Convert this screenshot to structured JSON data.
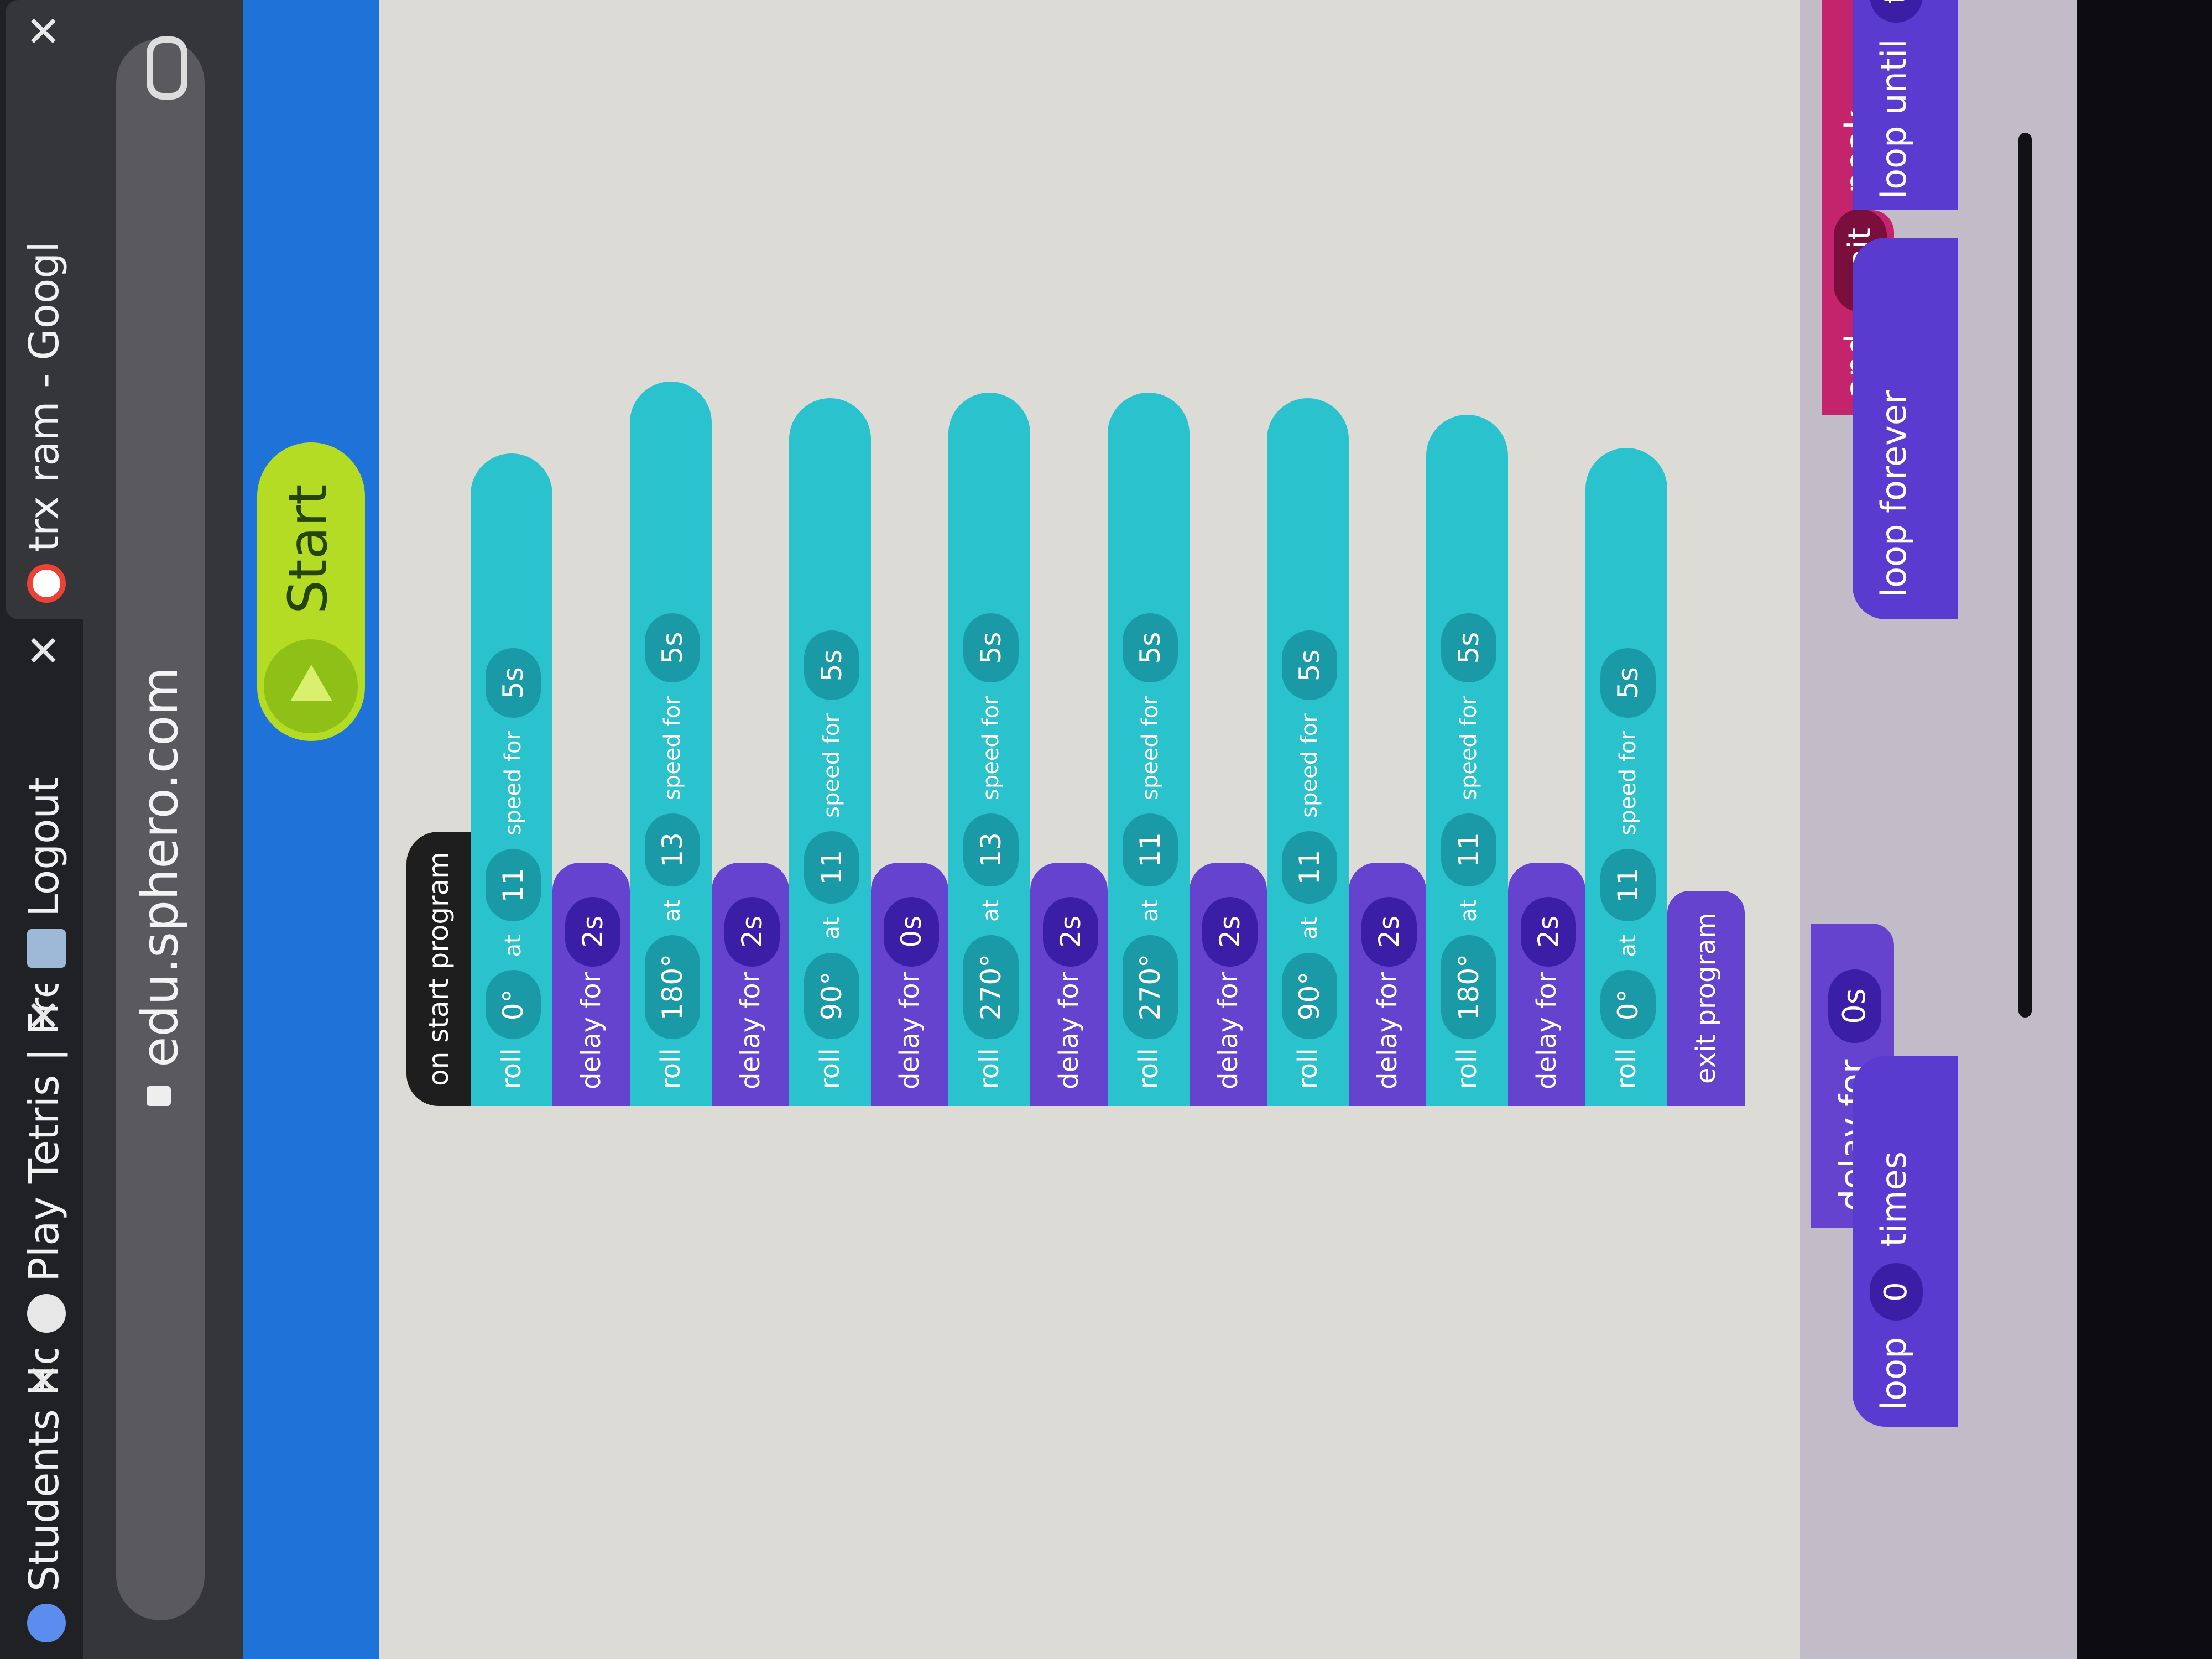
{
  "browser": {
    "tabs": [
      {
        "title": "Students Home",
        "icon": "students-icon"
      },
      {
        "title": "Play Tetris | Fre",
        "icon": "globe-icon"
      },
      {
        "title": "Logout",
        "icon": "app-icon"
      },
      {
        "title": "trx ram - Googl",
        "icon": "google-icon"
      }
    ],
    "close_glyph": "✕",
    "url": "edu.sphero.com"
  },
  "app": {
    "start_label": "Start"
  },
  "program": {
    "hat_label": "on start program",
    "roll_word": "roll",
    "at_word": "at",
    "speed_for_word": "speed for",
    "delay_word": "delay for",
    "steps": [
      {
        "heading": "0°",
        "speed": "11",
        "duration": "5s",
        "delay": "2s"
      },
      {
        "heading": "180°",
        "speed": "13",
        "duration": "5s",
        "delay": "2s"
      },
      {
        "heading": "90°",
        "speed": "11",
        "duration": "5s",
        "delay": "0s"
      },
      {
        "heading": "270°",
        "speed": "13",
        "duration": "5s",
        "delay": "2s"
      },
      {
        "heading": "270°",
        "speed": "11",
        "duration": "5s",
        "delay": "2s"
      },
      {
        "heading": "90°",
        "speed": "11",
        "duration": "5s",
        "delay": "2s"
      },
      {
        "heading": "180°",
        "speed": "11",
        "duration": "5s",
        "delay": "2s"
      },
      {
        "heading": "0°",
        "speed": "11",
        "duration": "5s",
        "delay": null
      }
    ],
    "exit_label": "exit program"
  },
  "palette": {
    "speak_label": "peak",
    "and_label": "and",
    "wait_label": "wait",
    "delay_label": "delay for",
    "delay_value": "0s",
    "loop_label": "loop",
    "loop_count": "0",
    "times_label": "times",
    "loop_forever_label": "loop forever",
    "loop_until_label": "loop until",
    "loop_until_value": "tru"
  },
  "colors": {
    "roll_block": "#29c2cd",
    "delay_block": "#6543cf",
    "start_button": "#b5dc24",
    "header": "#1f72d8"
  }
}
